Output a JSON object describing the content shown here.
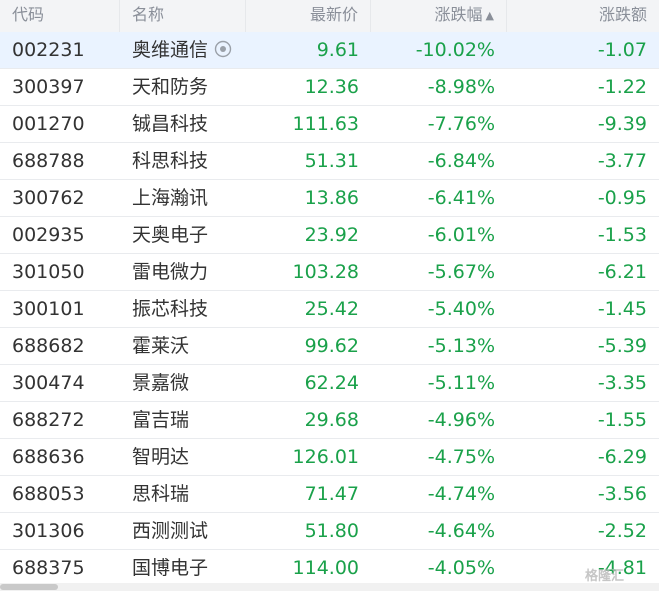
{
  "header": {
    "code": "代码",
    "name": "名称",
    "price": "最新价",
    "pct": "涨跌幅",
    "pct_sort_icon": "caret-up-icon",
    "chg": "涨跌额"
  },
  "rows": [
    {
      "code": "002231",
      "name": "奥维通信",
      "price": "9.61",
      "pct": "-10.02%",
      "chg": "-1.07"
    },
    {
      "code": "300397",
      "name": "天和防务",
      "price": "12.36",
      "pct": "-8.98%",
      "chg": "-1.22"
    },
    {
      "code": "001270",
      "name": "铖昌科技",
      "price": "111.63",
      "pct": "-7.76%",
      "chg": "-9.39"
    },
    {
      "code": "688788",
      "name": "科思科技",
      "price": "51.31",
      "pct": "-6.84%",
      "chg": "-3.77"
    },
    {
      "code": "300762",
      "name": "上海瀚讯",
      "price": "13.86",
      "pct": "-6.41%",
      "chg": "-0.95"
    },
    {
      "code": "002935",
      "name": "天奥电子",
      "price": "23.92",
      "pct": "-6.01%",
      "chg": "-1.53"
    },
    {
      "code": "301050",
      "name": "雷电微力",
      "price": "103.28",
      "pct": "-5.67%",
      "chg": "-6.21"
    },
    {
      "code": "300101",
      "name": "振芯科技",
      "price": "25.42",
      "pct": "-5.40%",
      "chg": "-1.45"
    },
    {
      "code": "688682",
      "name": "霍莱沃",
      "price": "99.62",
      "pct": "-5.13%",
      "chg": "-5.39"
    },
    {
      "code": "300474",
      "name": "景嘉微",
      "price": "62.24",
      "pct": "-5.11%",
      "chg": "-3.35"
    },
    {
      "code": "688272",
      "name": "富吉瑞",
      "price": "29.68",
      "pct": "-4.96%",
      "chg": "-1.55"
    },
    {
      "code": "688636",
      "name": "智明达",
      "price": "126.01",
      "pct": "-4.75%",
      "chg": "-6.29"
    },
    {
      "code": "688053",
      "name": "思科瑞",
      "price": "71.47",
      "pct": "-4.74%",
      "chg": "-3.56"
    },
    {
      "code": "301306",
      "name": "西测测试",
      "price": "51.80",
      "pct": "-4.64%",
      "chg": "-2.52"
    },
    {
      "code": "688375",
      "name": "国博电子",
      "price": "114.00",
      "pct": "-4.05%",
      "chg": "-4.81"
    }
  ],
  "colors": {
    "down": "#1aa14a",
    "header_bg": "#f3f4f6",
    "selected_bg": "#eaf3ff"
  },
  "watermark": "格隆汇"
}
